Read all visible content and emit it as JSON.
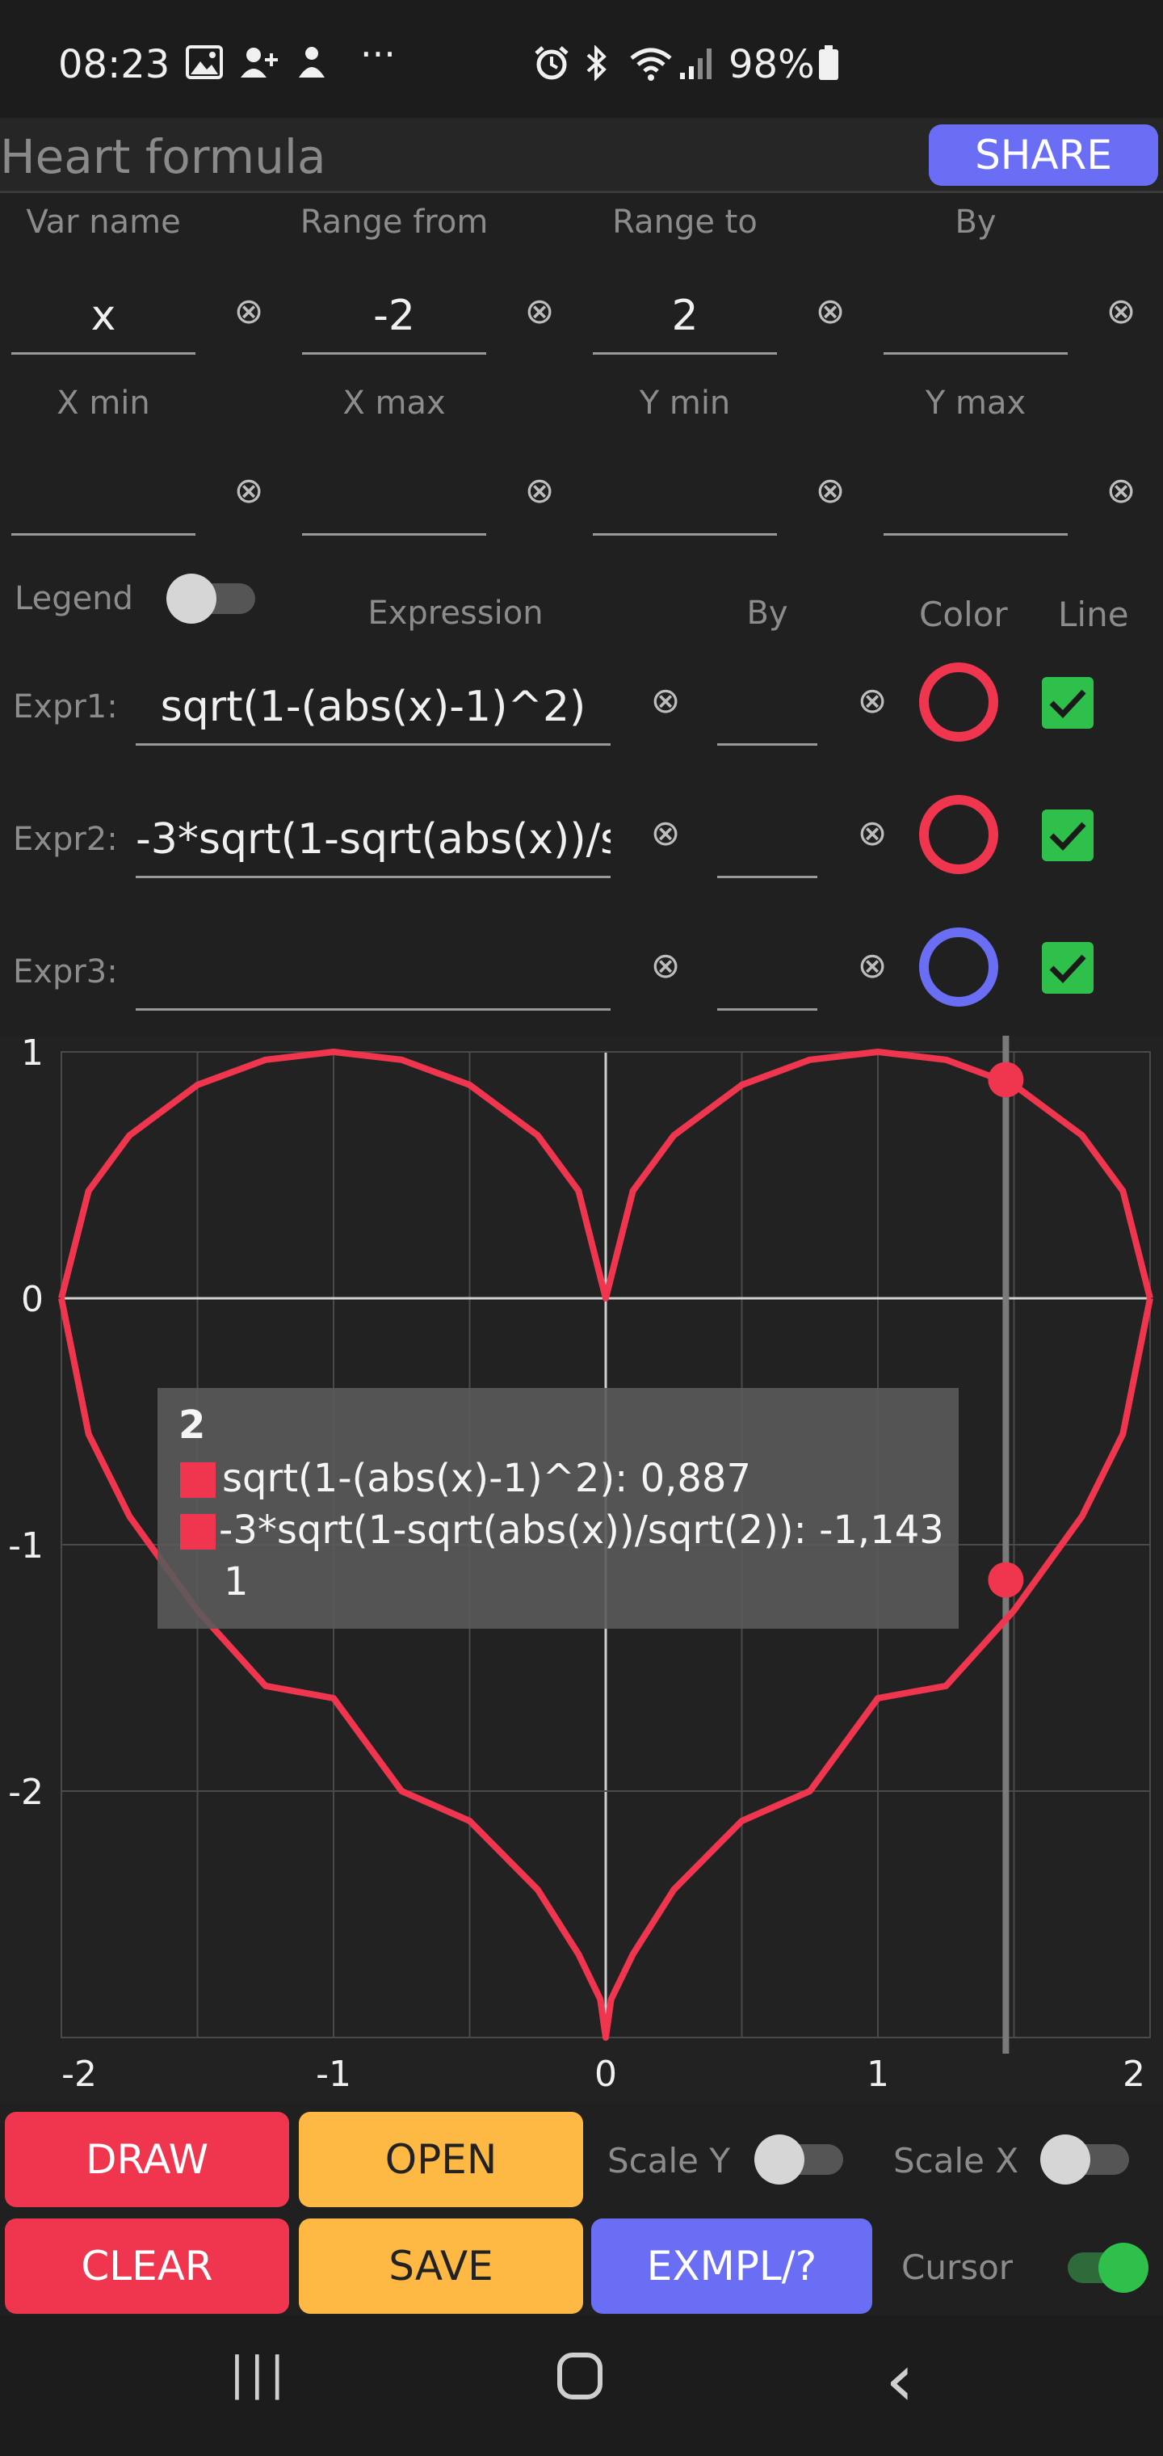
{
  "status_bar": {
    "time": "08:23",
    "dots": "···",
    "battery": "98%"
  },
  "title": "Heart formula",
  "share_label": "SHARE",
  "range_headers": [
    "Var name",
    "Range from",
    "Range to",
    "By"
  ],
  "range_values": [
    "x",
    "-2",
    "2",
    ""
  ],
  "limit_headers": [
    "X min",
    "X max",
    "Y min",
    "Y max"
  ],
  "limit_values": [
    "",
    "",
    "",
    ""
  ],
  "legend_label": "Legend",
  "expr_headers": {
    "expression": "Expression",
    "by": "By",
    "color": "Color",
    "line": "Line"
  },
  "expressions": [
    {
      "label": "Expr1:",
      "value": "sqrt(1-(abs(x)-1)^2)",
      "by": "",
      "color": "#f0364f",
      "line": true
    },
    {
      "label": "Expr2:",
      "value": "-3*sqrt(1-sqrt(abs(x))/s",
      "by": "",
      "color": "#f0364f",
      "line": true
    },
    {
      "label": "Expr3:",
      "value": "",
      "by": "",
      "color": "#6a6ef5",
      "line": true
    }
  ],
  "chart_data": {
    "type": "line",
    "xlim": [
      -2,
      2
    ],
    "ylim": [
      -3,
      1
    ],
    "x_ticks": [
      "-2",
      "-1",
      "0",
      "1",
      "2"
    ],
    "y_ticks": [
      "1",
      "0",
      "-1",
      "-2"
    ],
    "grid": true,
    "series": [
      {
        "name": "sqrt(1-(abs(x)-1)^2)",
        "color": "#f0364f",
        "x": [
          -2,
          -1.9,
          -1.75,
          -1.5,
          -1.25,
          -1,
          -0.75,
          -0.5,
          -0.25,
          -0.1,
          0,
          0.1,
          0.25,
          0.5,
          0.75,
          1,
          1.25,
          1.5,
          1.75,
          1.9,
          2
        ],
        "y": [
          0,
          0.436,
          0.661,
          0.866,
          0.968,
          1,
          0.968,
          0.866,
          0.661,
          0.436,
          0,
          0.436,
          0.661,
          0.866,
          0.968,
          1,
          0.968,
          0.866,
          0.661,
          0.436,
          0
        ]
      },
      {
        "name": "-3*sqrt(1-sqrt(abs(x))/sqrt(2))",
        "color": "#f0364f",
        "x": [
          -2,
          -1.9,
          -1.75,
          -1.5,
          -1.25,
          -1,
          -0.75,
          -0.5,
          -0.25,
          -0.1,
          -0.02,
          0,
          0.02,
          0.1,
          0.25,
          0.5,
          0.75,
          1,
          1.25,
          1.5,
          1.75,
          1.9,
          2
        ],
        "y": [
          0,
          -0.551,
          -0.885,
          -1.267,
          -1.573,
          -1.623,
          -2.0,
          -2.121,
          -2.4,
          -2.662,
          -2.845,
          -3,
          -2.845,
          -2.662,
          -2.4,
          -2.121,
          -2.0,
          -1.623,
          -1.573,
          -1.267,
          -0.885,
          -0.551,
          0
        ]
      }
    ],
    "cursor": {
      "x": 1.47,
      "points": [
        0.887,
        -1.143
      ]
    }
  },
  "tooltip": {
    "header": "2",
    "lines": [
      "sqrt(1-(abs(x)-1)^2): 0,887",
      "-3*sqrt(1-sqrt(abs(x))/sqrt(2)): -1,143"
    ],
    "footer": "1"
  },
  "buttons": {
    "draw": "DRAW",
    "open": "OPEN",
    "clear": "CLEAR",
    "save": "SAVE",
    "examples": "EXMPL/?"
  },
  "options": {
    "scale_y": "Scale Y",
    "scale_x": "Scale X",
    "cursor": "Cursor"
  },
  "nav": {
    "recents": "|||",
    "home": "○",
    "back": "‹"
  }
}
